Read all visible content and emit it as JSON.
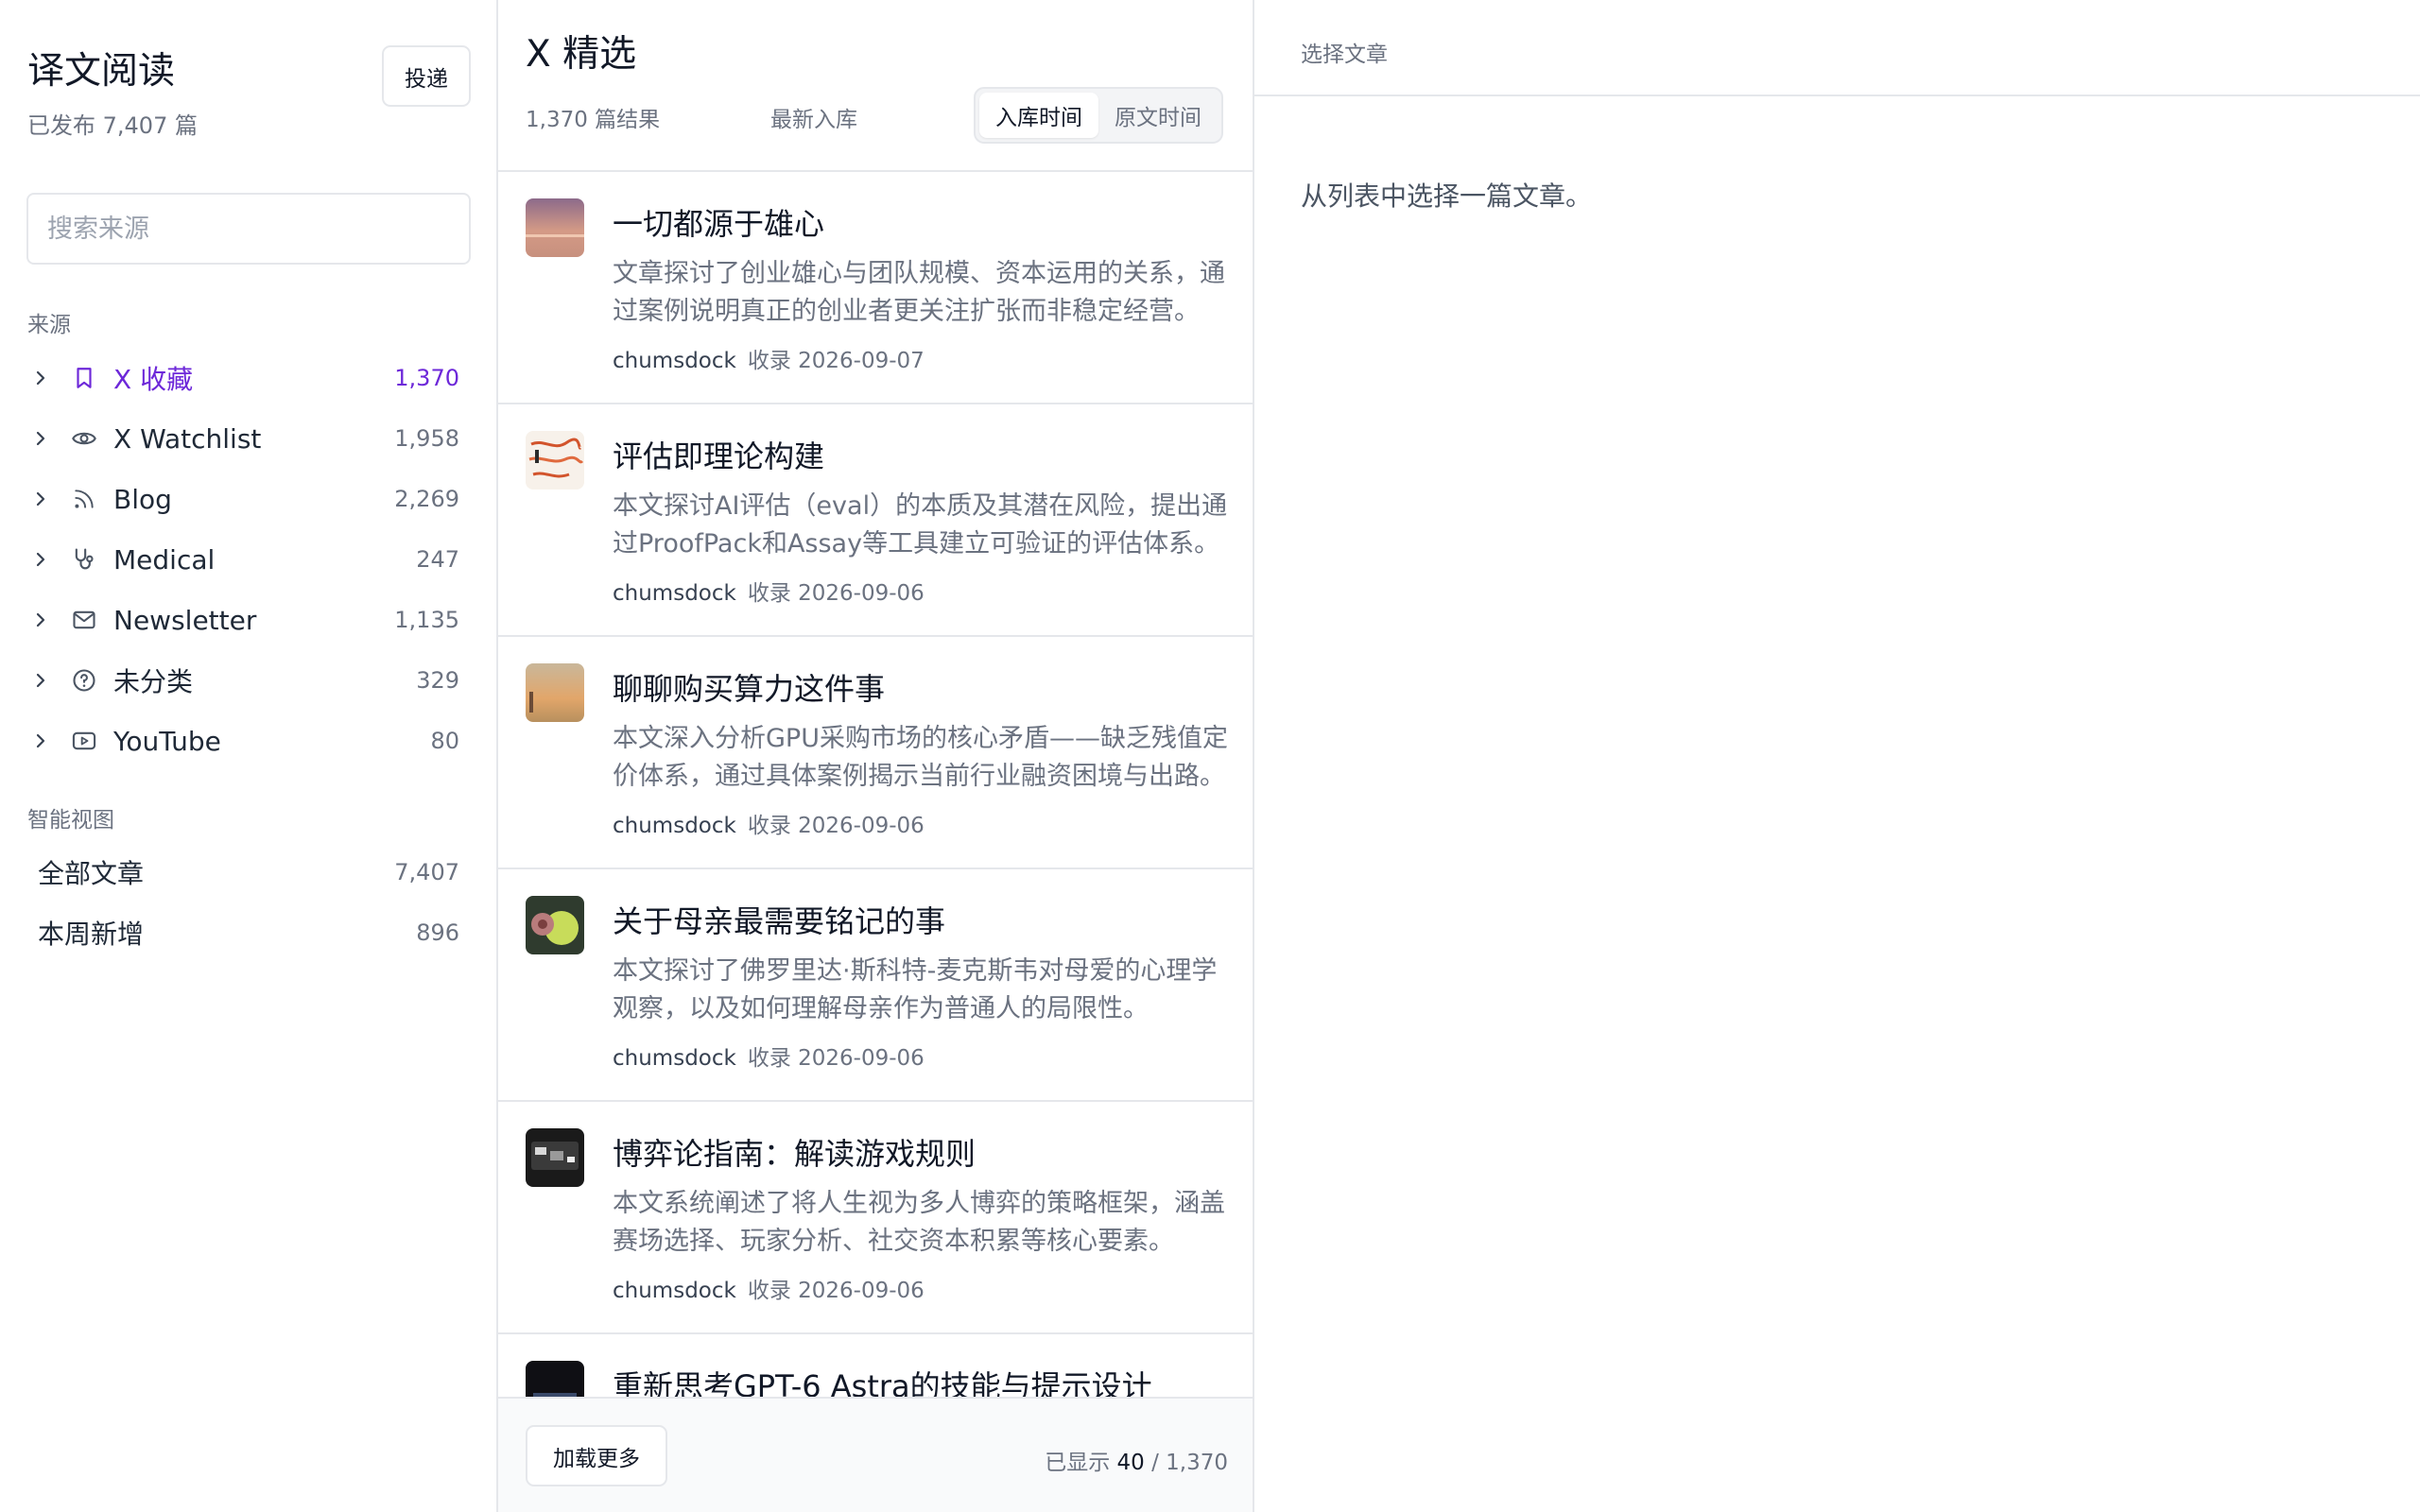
{
  "sidebar": {
    "title": "译文阅读",
    "subtitle": "已发布 7,407 篇",
    "submit_label": "投递",
    "search_placeholder": "搜索来源",
    "sources_label": "来源",
    "sources": [
      {
        "label": "X 收藏",
        "count": "1,370",
        "icon": "bookmark-icon",
        "active": true
      },
      {
        "label": "X Watchlist",
        "count": "1,958",
        "icon": "eye-icon"
      },
      {
        "label": "Blog",
        "count": "2,269",
        "icon": "rss-icon"
      },
      {
        "label": "Medical",
        "count": "247",
        "icon": "stethoscope-icon"
      },
      {
        "label": "Newsletter",
        "count": "1,135",
        "icon": "mail-icon"
      },
      {
        "label": "未分类",
        "count": "329",
        "icon": "question-circle-icon"
      },
      {
        "label": "YouTube",
        "count": "80",
        "icon": "youtube-icon"
      }
    ],
    "smart_label": "智能视图",
    "smart_views": [
      {
        "label": "全部文章",
        "count": "7,407"
      },
      {
        "label": "本周新增",
        "count": "896"
      }
    ]
  },
  "list": {
    "title": "X 精选",
    "result_count": "1,370 篇结果",
    "sort_label": "最新入库",
    "sort_options": [
      "入库时间",
      "原文时间"
    ],
    "articles": [
      {
        "title": "一切都源于雄心",
        "summary": "文章探讨了创业雄心与团队规模、资本运用的关系，通过案例说明真正的创业者更关注扩张而非稳定经营。",
        "author": "chumsdock",
        "meta": "收录 2026-09-07"
      },
      {
        "title": "评估即理论构建",
        "summary": "本文探讨AI评估（eval）的本质及其潜在风险，提出通过ProofPack和Assay等工具建立可验证的评估体系。",
        "author": "chumsdock",
        "meta": "收录 2026-09-06"
      },
      {
        "title": "聊聊购买算力这件事",
        "summary": "本文深入分析GPU采购市场的核心矛盾——缺乏残值定价体系，通过具体案例揭示当前行业融资困境与出路。",
        "author": "chumsdock",
        "meta": "收录 2026-09-06"
      },
      {
        "title": "关于母亲最需要铭记的事",
        "summary": "本文探讨了佛罗里达·斯科特-麦克斯韦对母爱的心理学观察，以及如何理解母亲作为普通人的局限性。",
        "author": "chumsdock",
        "meta": "收录 2026-09-06"
      },
      {
        "title": "博弈论指南：解读游戏规则",
        "summary": "本文系统阐述了将人生视为多人博弈的策略框架，涵盖赛场选择、玩家分析、社交资本积累等核心要素。",
        "author": "chumsdock",
        "meta": "收录 2026-09-06"
      },
      {
        "title": "重新思考GPT-6 Astra的技能与提示设计",
        "summary": "",
        "author": "",
        "meta": ""
      }
    ],
    "load_more": "加载更多",
    "shown_prefix": "已显示",
    "shown_count": "40",
    "shown_total": "/ 1,370"
  },
  "reader": {
    "header": "选择文章",
    "empty": "从列表中选择一篇文章。"
  },
  "colors": {
    "accent": "#6d28d9",
    "border": "#e5e7eb",
    "muted": "#6b7280"
  }
}
